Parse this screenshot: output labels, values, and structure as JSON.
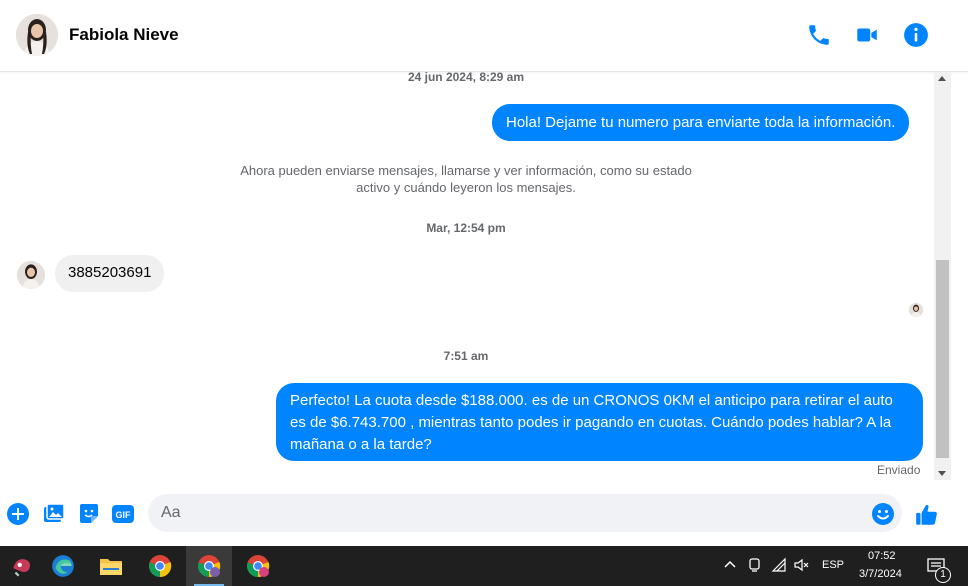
{
  "header": {
    "contact_name": "Fabiola Nieve",
    "icons": [
      "phone-icon",
      "video-icon",
      "info-icon"
    ]
  },
  "conversation": {
    "ts1": "24 jun 2024, 8:29 am",
    "msg1": "Hola! Dejame tu numero  para enviarte toda la información.",
    "system_note_line1": "Ahora pueden enviarse mensajes, llamarse y ver información, como su estado",
    "system_note_line2": "activo y cuándo leyeron los mensajes.",
    "ts2": "Mar, 12:54 pm",
    "msg2": "3885203691",
    "ts3": "7:51 am",
    "msg3_line1": "Perfecto! La cuota desde $188.000. es de un CRONOS 0KM el anticipo para retirar el auto",
    "msg3_line2": "es de $6.743.700 , mientras tanto podes ir pagando en cuotas. Cuándo podes hablar? A la",
    "msg3_line3": "mañana o a la tarde?",
    "status": "Enviado"
  },
  "composer": {
    "placeholder": "Aa",
    "icons": [
      "plus-icon",
      "photo-icon",
      "sticker-icon",
      "gif-icon",
      "emoji-icon",
      "like-icon"
    ]
  },
  "taskbar": {
    "language": "ESP",
    "time": "07:52",
    "date": "3/7/2024",
    "notification_count": "1"
  },
  "colors": {
    "accent": "#0084ff",
    "taskbar": "#1f1f1f"
  }
}
